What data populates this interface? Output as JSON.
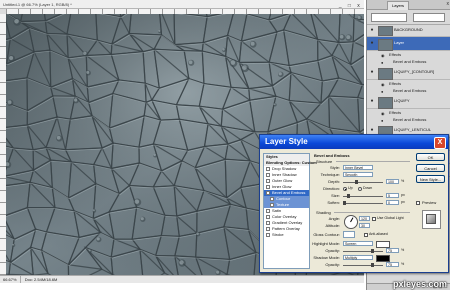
{
  "document": {
    "title": "Untitled-1 @ 66.7% (Layer 1, RGB/8) *",
    "window_controls": [
      "_",
      "□",
      "x"
    ],
    "zoom": "66.67%",
    "status_info": "Doc: 2.54M/18.6M"
  },
  "layers_panel": {
    "tab_label": "Layers",
    "close_glyph": "x",
    "layers": [
      {
        "name": "BACKGROUND",
        "selected": false
      },
      {
        "name": "Layer",
        "selected": true
      },
      {
        "name": "LIQUIFY_[CONTOUR]",
        "selected": false
      },
      {
        "name": "LIQUIFY",
        "selected": false
      },
      {
        "name": "LIQUIFY_LENTICUL",
        "selected": false
      },
      {
        "name": "Leaf Structure",
        "selected": false
      },
      {
        "name": "Background Gradient",
        "selected": false
      },
      {
        "name": "Layer 0",
        "selected": false
      }
    ],
    "effects_label": "Effects",
    "effect_items": [
      "Bevel and Emboss",
      "Bevel and Emboss",
      "Bevel and Emboss"
    ],
    "footer_glyph": "⊞ ⊡ ✕"
  },
  "dialog": {
    "title": "Layer Style",
    "close_glyph": "X",
    "styles": [
      {
        "label": "Styles",
        "kind": "head"
      },
      {
        "label": "Blending Options: Custom",
        "kind": "head"
      },
      {
        "label": "Drop Shadow",
        "kind": "item"
      },
      {
        "label": "Inner Shadow",
        "kind": "item"
      },
      {
        "label": "Outer Glow",
        "kind": "item"
      },
      {
        "label": "Inner Glow",
        "kind": "item"
      },
      {
        "label": "Bevel and Emboss",
        "kind": "active"
      },
      {
        "label": "Contour",
        "kind": "sub"
      },
      {
        "label": "Texture",
        "kind": "sub"
      },
      {
        "label": "Satin",
        "kind": "item"
      },
      {
        "label": "Color Overlay",
        "kind": "item"
      },
      {
        "label": "Gradient Overlay",
        "kind": "item"
      },
      {
        "label": "Pattern Overlay",
        "kind": "item"
      },
      {
        "label": "Stroke",
        "kind": "item"
      }
    ],
    "structure": {
      "group_title": "Bevel and Emboss",
      "subtitle": "Structure",
      "style_label": "Style:",
      "style_value": "Inner Bevel",
      "technique_label": "Technique:",
      "technique_value": "Smooth",
      "depth_label": "Depth:",
      "depth_value": "100",
      "depth_unit": "%",
      "direction_label": "Direction:",
      "direction_up": "Up",
      "direction_down": "Down",
      "size_label": "Size:",
      "size_value": "5",
      "size_unit": "px",
      "soften_label": "Soften:",
      "soften_value": "0",
      "soften_unit": "px"
    },
    "shading": {
      "subtitle": "Shading",
      "angle_label": "Angle:",
      "angle_value": "120",
      "global_light": "Use Global Light",
      "altitude_label": "Altitude:",
      "altitude_value": "30",
      "gloss_label": "Gloss Contour:",
      "anti_aliased": "Anti-aliased",
      "highlight_label": "Highlight Mode:",
      "highlight_value": "Screen",
      "opacity_label": "Opacity:",
      "opacity_value": "75",
      "opacity_unit": "%",
      "shadow_label": "Shadow Mode:",
      "shadow_value": "Multiply",
      "opacity2_label": "Opacity:",
      "opacity2_value": "75",
      "opacity2_unit": "%"
    },
    "buttons": {
      "ok": "OK",
      "cancel": "Cancel",
      "new_style": "New Style...",
      "preview": "Preview"
    }
  },
  "watermark": "pxleyes.com"
}
